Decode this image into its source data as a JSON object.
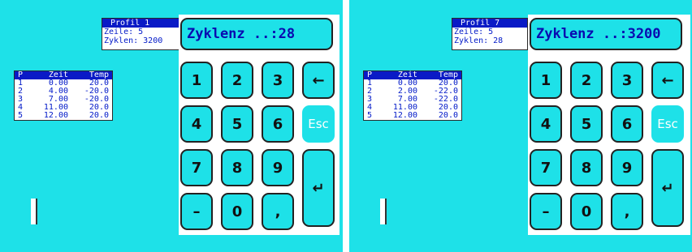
{
  "colors": {
    "background": "#1ee1e8",
    "highlight": "#0a1ac6",
    "text_blue": "#0018c8"
  },
  "screens": [
    {
      "info": {
        "profile": "Profil 1",
        "line": "Zeile: 5",
        "cycles": "Zyklen: 3200"
      },
      "table": {
        "headers": [
          "P",
          "Zeit",
          "Temp"
        ],
        "rows": [
          [
            "1",
            "0.00",
            "20.0"
          ],
          [
            "2",
            "4.00",
            "-20.0"
          ],
          [
            "3",
            "7.00",
            "-20.0"
          ],
          [
            "4",
            "11.00",
            "20.0"
          ],
          [
            "5",
            "12.00",
            "20.0"
          ]
        ]
      },
      "input_display": "Zyklenz ..:28"
    },
    {
      "info": {
        "profile": "Profil 7",
        "line": "Zeile: 5",
        "cycles": "Zyklen: 28"
      },
      "table": {
        "headers": [
          "P",
          "Zeit",
          "Temp"
        ],
        "rows": [
          [
            "1",
            "0.00",
            "20.0"
          ],
          [
            "2",
            "2.00",
            "-22.0"
          ],
          [
            "3",
            "7.00",
            "-22.0"
          ],
          [
            "4",
            "11.00",
            "20.0"
          ],
          [
            "5",
            "12.00",
            "20.0"
          ]
        ]
      },
      "input_display": "Zyklenz ..:3200"
    }
  ],
  "keypad": {
    "digits": [
      "1",
      "2",
      "3",
      "4",
      "5",
      "6",
      "7",
      "8",
      "9",
      "–",
      "0",
      ","
    ],
    "backspace": "←",
    "esc": "Esc",
    "enter": "↵"
  }
}
